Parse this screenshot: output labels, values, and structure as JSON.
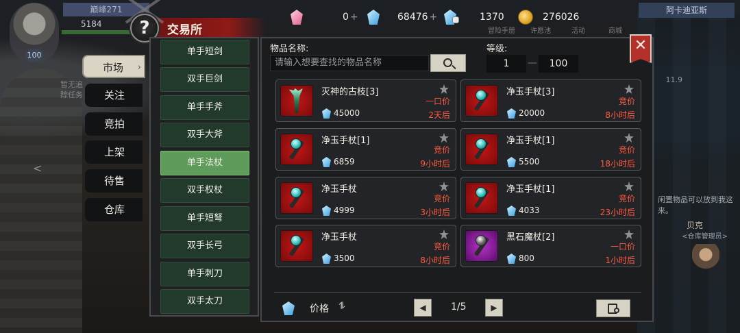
{
  "hud": {
    "player_title": "巅峰271",
    "player_number": "5184",
    "avatar_level": "100",
    "side_text_1": "暂无追",
    "side_text_2": "踪任务",
    "location": "阿卡迪亚斯",
    "menu_items": [
      "冒险手册",
      "许愿池",
      "活动",
      "商城"
    ],
    "small_number": "11.9",
    "right_note": "闲置物品可以放到我这来。",
    "npc_name": "贝克",
    "npc_role": "<仓库管理员>"
  },
  "currency": {
    "pink_gem_value": "0",
    "blue_gem_value": "68476",
    "bound_gem_value": "1370",
    "gold_value": "276026",
    "plus": "+"
  },
  "title": "交易所",
  "help_symbol": "?",
  "left_tabs": [
    "市场",
    "关注",
    "竞拍",
    "上架",
    "待售",
    "仓库"
  ],
  "categories": [
    "单手短剑",
    "双手巨剑",
    "单手手斧",
    "双手大斧",
    "单手法杖",
    "双手权杖",
    "单手短弩",
    "双手长弓",
    "单手刺刀",
    "双手太刀"
  ],
  "active_category_index": 4,
  "search": {
    "label": "物品名称:",
    "placeholder": "请输入想要查找的物品名称",
    "level_label": "等级:",
    "level_min": "1",
    "level_max": "100",
    "level_dash": "—"
  },
  "close_symbol": "✕",
  "listings": [
    {
      "name": "灭神的古枝[3]",
      "type": "一口价",
      "price": "45000",
      "time": "2天后",
      "icon": "branch-icon",
      "bg": "red"
    },
    {
      "name": "净玉手杖[3]",
      "type": "竞价",
      "price": "20000",
      "time": "8小时后",
      "icon": "jade-staff-icon",
      "bg": "red"
    },
    {
      "name": "净玉手杖[1]",
      "type": "竞价",
      "price": "6859",
      "time": "9小时后",
      "icon": "jade-staff-icon",
      "bg": "red"
    },
    {
      "name": "净玉手杖[1]",
      "type": "竞价",
      "price": "5500",
      "time": "18小时后",
      "icon": "jade-staff-icon",
      "bg": "red"
    },
    {
      "name": "净玉手杖",
      "type": "竞价",
      "price": "4999",
      "time": "3小时后",
      "icon": "jade-staff-icon",
      "bg": "red"
    },
    {
      "name": "净玉手杖[1]",
      "type": "竞价",
      "price": "4033",
      "time": "23小时后",
      "icon": "jade-staff-icon",
      "bg": "red"
    },
    {
      "name": "净玉手杖",
      "type": "竞价",
      "price": "3500",
      "time": "8小时后",
      "icon": "jade-staff-icon",
      "bg": "red"
    },
    {
      "name": "黑石魔杖[2]",
      "type": "一口价",
      "price": "800",
      "time": "1小时后",
      "icon": "black-stone-wand-icon",
      "bg": "purple"
    }
  ],
  "footer": {
    "sort_label": "价格",
    "sort_icon": "⥮",
    "prev": "◀",
    "next": "▶",
    "page": "1/5"
  },
  "colors": {
    "accent_red": "#b3312a",
    "category_active": "#5f9b5a",
    "category": "#223a2c",
    "sale_type_text": "#ff5a3e"
  }
}
